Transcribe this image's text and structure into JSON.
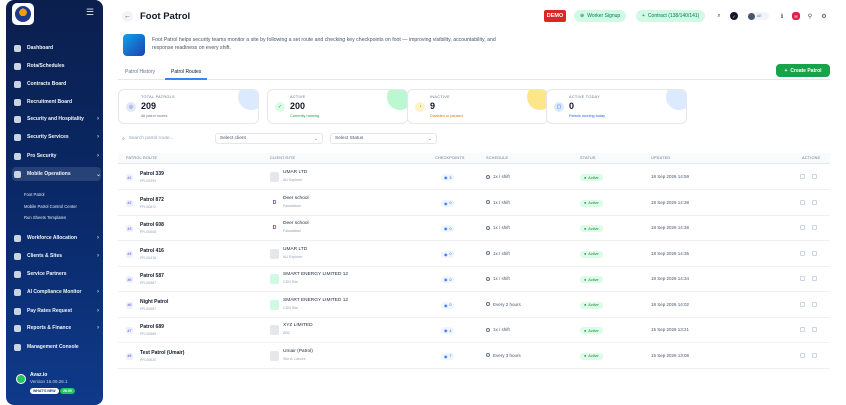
{
  "sidebar": {
    "items": [
      {
        "label": "Dashboard",
        "chev": ""
      },
      {
        "label": "Rota/Schedules",
        "chev": ""
      },
      {
        "label": "Contracts Board",
        "chev": ""
      },
      {
        "label": "Recruitment Board",
        "chev": ""
      },
      {
        "label": "Security and Hospitality",
        "chev": "›"
      },
      {
        "label": "Security Services",
        "chev": "›"
      },
      {
        "label": "Pro Security",
        "chev": "›"
      },
      {
        "label": "Mobile Operations",
        "chev": "⌄"
      }
    ],
    "subitems": [
      "Foot Patrol",
      "Mobile Patrol Control Center",
      "Run Sheets Templates"
    ],
    "items2": [
      {
        "label": "Workforce Allocation",
        "chev": "›"
      },
      {
        "label": "Clients & Sites",
        "chev": "›"
      },
      {
        "label": "Service Partners",
        "chev": ""
      },
      {
        "label": "AI Compliance Monitor",
        "chev": "›"
      },
      {
        "label": "Pay Rates Request",
        "chev": "›"
      },
      {
        "label": "Reports & Finance",
        "chev": "›"
      },
      {
        "label": "Management Console",
        "chev": ""
      }
    ],
    "footer": {
      "name": "Avaz.io",
      "version": "Version 16.09.26.1",
      "whats_new": "WHAT'S NEW",
      "badge": "26.09"
    }
  },
  "header": {
    "title": "Foot Patrol",
    "demo": "DEMO",
    "worker_signup": "Worker Signup",
    "contract": "Contract (138/140/141)",
    "user_initials": "AE"
  },
  "description": "Foot Patrol helps security teams monitor a site by following a set route and checking key checkpoints on foot — improving visibility, accountability, and response readiness on every shift.",
  "tabs": [
    "Patrol History",
    "Patrol Routes"
  ],
  "create_button": "Create Patrol",
  "stats": [
    {
      "label": "TOTAL PATROLS",
      "value": "209",
      "sub": "All patrol routes",
      "color": "#64748b",
      "bg": "#dbeafe",
      "iconbg": "#e0e7ff",
      "icon": "◎"
    },
    {
      "label": "ACTIVE",
      "value": "200",
      "sub": "Currently running",
      "color": "#16a34a",
      "bg": "#bbf7d0",
      "iconbg": "#dcfce7",
      "icon": "✓"
    },
    {
      "label": "INACTIVE",
      "value": "9",
      "sub": "Disabled or paused",
      "color": "#d97706",
      "bg": "#fde68a",
      "iconbg": "#fef3c7",
      "icon": "◔"
    },
    {
      "label": "ACTIVE TODAY",
      "value": "0",
      "sub": "Patrols running today",
      "color": "#2563eb",
      "bg": "#dbeafe",
      "iconbg": "#dbeafe",
      "icon": "▢"
    }
  ],
  "filters": {
    "search_placeholder": "Search patrol route...",
    "client": "Select client",
    "status": "Select Status"
  },
  "table": {
    "headers": [
      "PATROL ROUTE",
      "CLIENT/SITE",
      "CHECKPOINTS",
      "SCHEDULE",
      "STATUS",
      "UPDATED",
      "ACTIONS"
    ],
    "rows": [
      {
        "id": "#1",
        "name": "Patrol 339",
        "code": "PR-00339",
        "client": "UMAR LTD",
        "site": "AU Explorer",
        "logo": "",
        "logo_bg": "#e5e7eb",
        "logo_color": "#6b7280",
        "cp": "3",
        "schedule": "1x / shift",
        "status": "Active",
        "updated": "18 Sep 2026 14:59"
      },
      {
        "id": "#2",
        "name": "Patrol 872",
        "code": "PR-00872",
        "client": "Deer school",
        "site": "Faisalabad",
        "logo": "D",
        "logo_bg": "#ffffff",
        "logo_color": "#6d28d9",
        "cp": "0",
        "schedule": "1x / shift",
        "status": "Active",
        "updated": "18 Sep 2026 14:38"
      },
      {
        "id": "#3",
        "name": "Patrol 608",
        "code": "PR-00608",
        "client": "Deer school",
        "site": "Faisalabad",
        "logo": "D",
        "logo_bg": "#ffffff",
        "logo_color": "#6d28d9",
        "cp": "0",
        "schedule": "1x / shift",
        "status": "Active",
        "updated": "18 Sep 2026 14:38"
      },
      {
        "id": "#4",
        "name": "Patrol 416",
        "code": "PR-00416",
        "client": "UMAR LTD",
        "site": "AU Explorer",
        "logo": "",
        "logo_bg": "#e5e7eb",
        "logo_color": "#6b7280",
        "cp": "0",
        "schedule": "1x / shift",
        "status": "Active",
        "updated": "18 Sep 2026 14:35"
      },
      {
        "id": "#5",
        "name": "Patrol 587",
        "code": "PR-00587",
        "client": "SMART ENERGY LIMITED 12",
        "site": "CDN Site",
        "logo": "",
        "logo_bg": "#d1fae5",
        "logo_color": "#047857",
        "cp": "0",
        "schedule": "1x / shift",
        "status": "Active",
        "updated": "18 Sep 2026 14:34"
      },
      {
        "id": "#6",
        "name": "Night Patrol",
        "code": "PR-00587",
        "client": "SMART ENERGY LIMITED 12",
        "site": "CDN Site",
        "logo": "",
        "logo_bg": "#d1fae5",
        "logo_color": "#047857",
        "cp": "0",
        "schedule": "Every 2 hours",
        "status": "Active",
        "updated": "18 Sep 2026 14:02"
      },
      {
        "id": "#7",
        "name": "Patrol 689",
        "code": "PR-00689",
        "client": "XYZ LIMITED",
        "site": "ABC",
        "logo": "",
        "logo_bg": "#e5e7eb",
        "logo_color": "#6b7280",
        "cp": "4",
        "schedule": "1x / shift",
        "status": "Active",
        "updated": "15 Sep 2026 13:21"
      },
      {
        "id": "#8",
        "name": "Test Patrol (Umair)",
        "code": "PR-00620",
        "client": "Umair (Patrol)",
        "site": "Site A, Lahore",
        "logo": "",
        "logo_bg": "#e5e7eb",
        "logo_color": "#6b7280",
        "cp": "7",
        "schedule": "Every 3 hours",
        "status": "Active",
        "updated": "15 Sep 2026 13:08"
      }
    ]
  }
}
